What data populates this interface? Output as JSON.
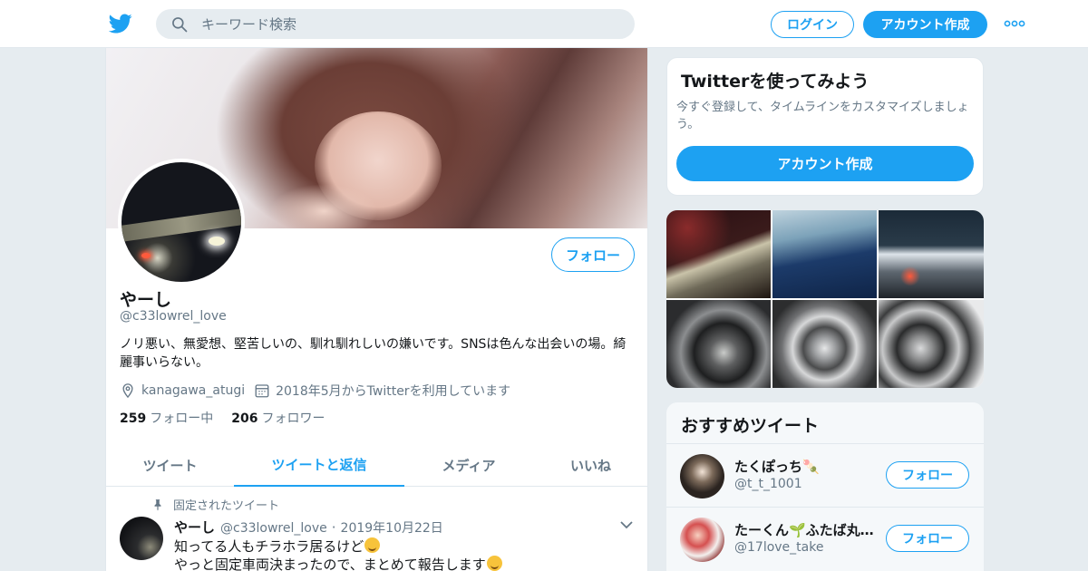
{
  "topbar": {
    "search_placeholder": "キーワード検索",
    "login_label": "ログイン",
    "signup_label": "アカウント作成",
    "accent_color": "#1da1f2"
  },
  "profile": {
    "name": "やーし",
    "handle": "@c33lowrel_love",
    "follow_label": "フォロー",
    "bio": "ノリ悪い、無愛想、堅苦しいの、馴れ馴れしいの嫌いです。SNSは色んな出会いの場。綺麗事いらない。",
    "location": "kanagawa_atugi",
    "joined": "2018年5月からTwitterを利用しています",
    "following_count": "259",
    "following_label": "フォロー中",
    "followers_count": "206",
    "followers_label": "フォロワー"
  },
  "tabs": [
    {
      "label": "ツイート",
      "active": false
    },
    {
      "label": "ツイートと返信",
      "active": true
    },
    {
      "label": "メディア",
      "active": false
    },
    {
      "label": "いいね",
      "active": false
    }
  ],
  "pinned_tweet": {
    "pinned_label": "固定されたツイート",
    "author_name": "やーし",
    "author_handle": "@c33lowrel_love",
    "separator": "·",
    "date": "2019年10月22日",
    "line1": "知ってる人もチラホラ居るけど",
    "line2": "やっと固定車両決まったので、まとめて報告します"
  },
  "signup_card": {
    "title": "Twitterを使ってみよう",
    "description": "今すぐ登録して、タイムラインをカスタマイズしましょう。",
    "button_label": "アカウント作成"
  },
  "recommended": {
    "title": "おすすめツイート",
    "users": [
      {
        "name": "たくぽっち🍡",
        "handle": "@t_t_1001",
        "follow_label": "フォロー"
      },
      {
        "name": "たーくん🌱ふたば丸…",
        "handle": "@17love_take",
        "follow_label": "フォロー"
      }
    ]
  },
  "icons": {
    "logo": "twitter-bird-icon",
    "search": "search-icon",
    "more": "more-dots-icon",
    "location": "location-pin-icon",
    "calendar": "calendar-icon",
    "pin": "pin-icon",
    "chevron": "chevron-down-icon"
  }
}
